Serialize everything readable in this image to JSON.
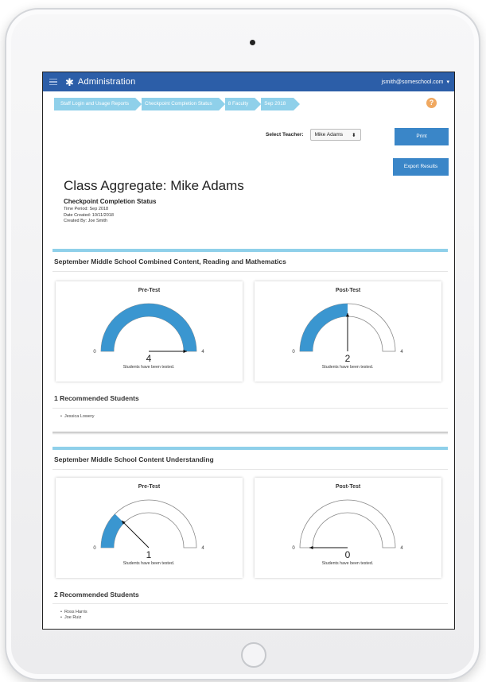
{
  "header": {
    "app_title": "Administration",
    "user_email": "jsmith@someschool.com",
    "user_caret": "▾",
    "gear_glyph": "✱"
  },
  "breadcrumb": [
    "Staff Login and Usage Reports",
    "Checkpoint Completion Status",
    "8 Faculty",
    "Sep 2018"
  ],
  "help_glyph": "?",
  "teacher_select": {
    "label": "Select Teacher:",
    "value": "Mike Adams",
    "arrows": "⬍"
  },
  "buttons": {
    "print": "Print",
    "export": "Export Results"
  },
  "report": {
    "title": "Class Aggregate: Mike Adams",
    "subtitle": "Checkpoint Completion Status",
    "time_period": "Time Period: Sep 2018",
    "date_created": "Date Created: 10/11/2018",
    "created_by": "Created By: Joe Smith"
  },
  "sections": [
    {
      "title": "September Middle School Combined Content, Reading and Mathematics",
      "gauges": [
        {
          "title": "Pre-Test",
          "min": "0",
          "max": "4",
          "value": 4,
          "value_label": "4",
          "caption": "Students have been tested."
        },
        {
          "title": "Post-Test",
          "min": "0",
          "max": "4",
          "value": 2,
          "value_label": "2",
          "caption": "Students have been tested."
        }
      ],
      "recommended_title": "1 Recommended Students",
      "students": [
        "Jessica Lowery"
      ]
    },
    {
      "title": "September Middle School Content Understanding",
      "gauges": [
        {
          "title": "Pre-Test",
          "min": "0",
          "max": "4",
          "value": 1,
          "value_label": "1",
          "caption": "Students have been tested."
        },
        {
          "title": "Post-Test",
          "min": "0",
          "max": "4",
          "value": 0,
          "value_label": "0",
          "caption": "Students have been tested."
        }
      ],
      "recommended_title": "2 Recommended Students",
      "students": [
        "Ross Harris",
        "Joe Ruiz"
      ]
    }
  ],
  "colors": {
    "brand": "#2c5ea8",
    "accent": "#3a86c8",
    "gauge_fill": "#3a96d0",
    "breadcrumb": "#8fd0ea",
    "help": "#f0a860"
  }
}
